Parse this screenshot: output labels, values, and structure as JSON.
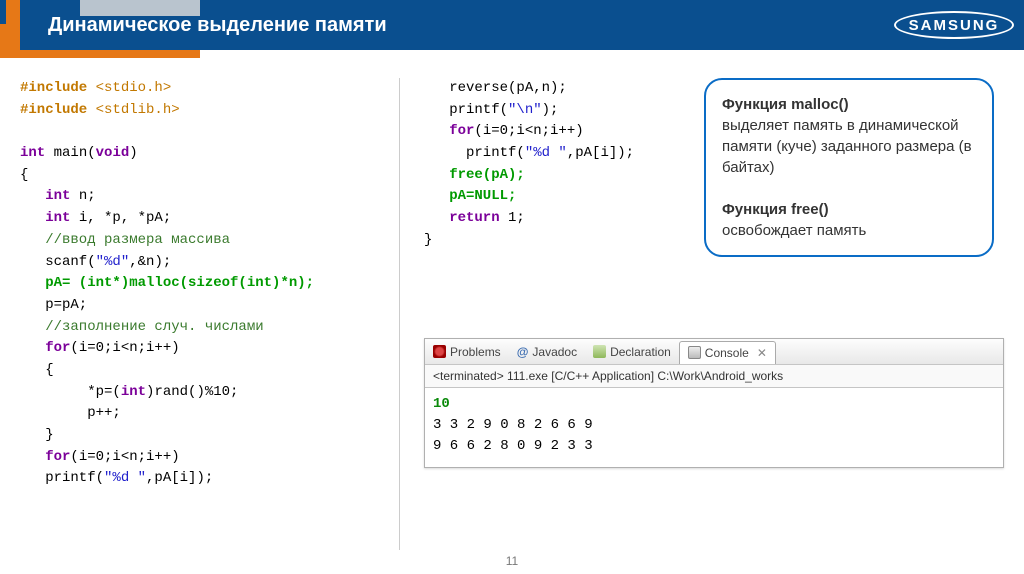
{
  "header": {
    "title": "Динамическое выделение памяти",
    "brand": "SAMSUNG"
  },
  "code_left": {
    "l1a": "#include",
    "l1b": " <stdio.h>",
    "l2a": "#include",
    "l2b": " <stdlib.h>",
    "l3": "",
    "l4a": "int",
    "l4b": " main(",
    "l4c": "void",
    "l4d": ")",
    "l5": "{",
    "l6a": "   int",
    "l6b": " n;",
    "l7a": "   int",
    "l7b": " i, *p, *pA;",
    "l8": "   //ввод размера массива",
    "l9a": "   scanf(",
    "l9b": "\"%d\"",
    "l9c": ",&n);",
    "l10": "   pA= (int*)malloc(sizeof(int)*n);",
    "l11": "   p=pA;",
    "l12": "   //заполнение случ. числами",
    "l13a": "   for",
    "l13b": "(i=0;i<n;i++)",
    "l14": "   {",
    "l15a": "        *p=(",
    "l15b": "int",
    "l15c": ")rand()%10;",
    "l16": "        p++;",
    "l17": "   }",
    "l18a": "   for",
    "l18b": "(i=0;i<n;i++)",
    "l19a": "   printf(",
    "l19b": "\"%d \"",
    "l19c": ",pA[i]);"
  },
  "code_right": {
    "r1": "   reverse(pA,n);",
    "r2a": "   printf(",
    "r2b": "\"\\n\"",
    "r2c": ");",
    "r3a": "   for",
    "r3b": "(i=0;i<n;i++)",
    "r4a": "     printf(",
    "r4b": "\"%d \"",
    "r4c": ",pA[i]);",
    "r5": "   free(pA);",
    "r6": "   pA=NULL;",
    "r7a": "   return",
    "r7b": " 1;",
    "r8": "}"
  },
  "info": {
    "p1a": "Функция malloc()",
    "p1b": "выделяет память в динамической памяти (куче) заданного размера (в байтах)",
    "p2a": "Функция free()",
    "p2b": "освобождает память"
  },
  "console": {
    "tabs": {
      "problems": "Problems",
      "javadoc": "Javadoc",
      "declaration": "Declaration",
      "console": "Console"
    },
    "terminated": "<terminated> 111.exe [C/C++ Application] C:\\Work\\Android_works",
    "input": "10",
    "out1": "3 3 2 9 0 8 2 6 6 9",
    "out2": "9 6 6 2 8 0 9 2 3 3"
  },
  "page_number": "11"
}
